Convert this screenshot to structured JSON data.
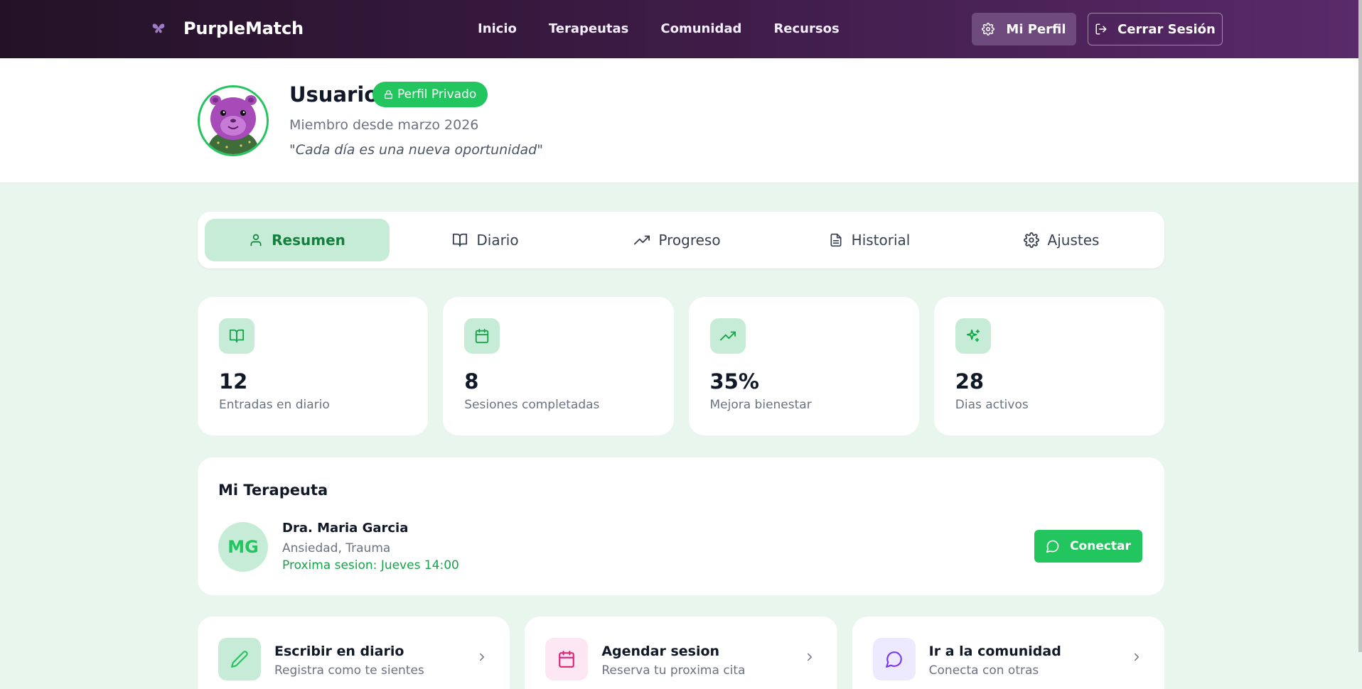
{
  "nav": {
    "brand": "PurpleMatch",
    "brand_icon": "butterfly-icon",
    "links": [
      "Inicio",
      "Terapeutas",
      "Comunidad",
      "Recursos"
    ],
    "profile_label": "Mi Perfil",
    "profile_icon": "gear-icon",
    "logout_label": "Cerrar Sesión",
    "logout_icon": "logout-icon"
  },
  "profile": {
    "name": "Usuario",
    "badge": "Perfil Privado",
    "badge_icon": "lock-icon",
    "member_since": "Miembro desde marzo 2026",
    "quote": "\"Cada día es una nueva oportunidad\"",
    "avatar_icon": "capybara-avatar"
  },
  "tabs": [
    {
      "label": "Resumen",
      "icon": "user-icon",
      "active": true
    },
    {
      "label": "Diario",
      "icon": "book-open-icon",
      "active": false
    },
    {
      "label": "Progreso",
      "icon": "trending-up-icon",
      "active": false
    },
    {
      "label": "Historial",
      "icon": "file-text-icon",
      "active": false
    },
    {
      "label": "Ajustes",
      "icon": "gear-icon",
      "active": false
    }
  ],
  "stats": [
    {
      "value": "12",
      "label": "Entradas en diario",
      "icon": "book-open-icon"
    },
    {
      "value": "8",
      "label": "Sesiones completadas",
      "icon": "calendar-icon"
    },
    {
      "value": "35%",
      "label": "Mejora bienestar",
      "icon": "trending-up-icon"
    },
    {
      "value": "28",
      "label": "Dias activos",
      "icon": "sparkles-icon"
    }
  ],
  "therapist": {
    "title": "Mi Terapeuta",
    "initials": "MG",
    "name": "Dra. Maria Garcia",
    "specialties": "Ansiedad, Trauma",
    "next_session": "Proxima sesion: Jueves 14:00",
    "connect_label": "Conectar",
    "connect_icon": "message-icon"
  },
  "actions": [
    {
      "title": "Escribir en diario",
      "subtitle": "Registra como te sientes",
      "icon": "pencil-icon",
      "color": "#22c55e",
      "bg": "#c6ecd7"
    },
    {
      "title": "Agendar sesion",
      "subtitle": "Reserva tu proxima cita",
      "icon": "calendar-icon",
      "color": "#db2777",
      "bg": "#fce7f3"
    },
    {
      "title": "Ir a la comunidad",
      "subtitle": "Conecta con otras",
      "icon": "message-icon",
      "color": "#7c3aed",
      "bg": "#ede9fe"
    }
  ],
  "colors": {
    "accent": "#22c55e",
    "accent_soft": "#c6ecd7",
    "nav_dark": "#231226",
    "nav_purple": "#5a2a6a"
  }
}
